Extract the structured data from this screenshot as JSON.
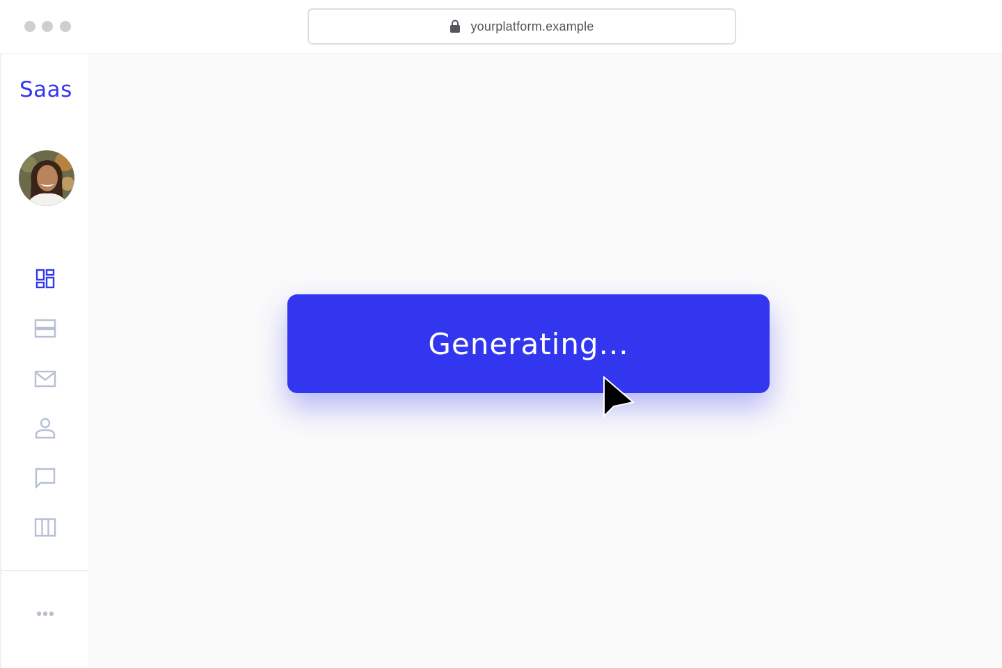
{
  "browser": {
    "url": "yourplatform.example",
    "icons": [
      "window-dot-icon",
      "lock-icon"
    ]
  },
  "sidebar": {
    "logo": "Saas",
    "nav_icons": [
      "dashboard-icon",
      "rows-icon",
      "mail-icon",
      "user-icon",
      "chat-icon",
      "columns-icon",
      "more-icon"
    ]
  },
  "main": {
    "button_label": "Generating..."
  },
  "colors": {
    "accent": "#3336ef",
    "icon_active": "#3338ee",
    "icon_inactive": "#b7bfd3"
  }
}
